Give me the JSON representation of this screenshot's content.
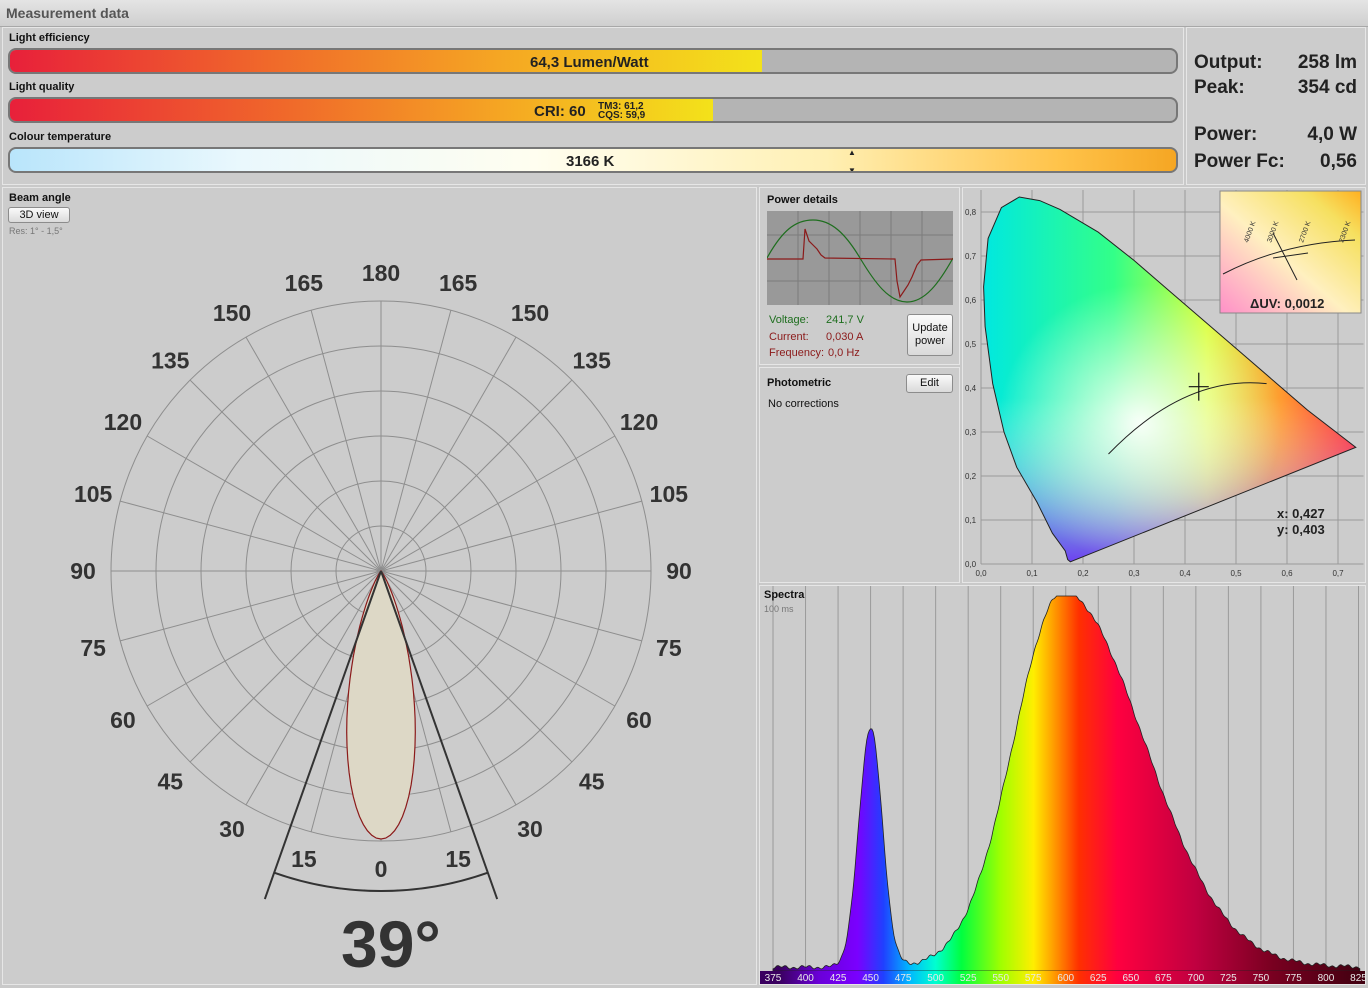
{
  "window": {
    "title": "Measurement data"
  },
  "efficiency": {
    "label": "Light efficiency",
    "value_text": "64,3 Lumen/Watt",
    "fill_fraction": 0.645
  },
  "quality": {
    "label": "Light quality",
    "cri_text": "CRI: 60",
    "tm3_text": "TM3: 61,2",
    "cqs_text": "CQS: 59,9",
    "fill_fraction": 0.603
  },
  "colour_temp": {
    "label": "Colour temperature",
    "value_text": "3166 K"
  },
  "stats": {
    "output_label": "Output:",
    "output_value": "258 lm",
    "peak_label": "Peak:",
    "peak_value": "354 cd",
    "power_label": "Power:",
    "power_value": "4,0 W",
    "powerfc_label": "Power Fc:",
    "powerfc_value": "0,56"
  },
  "beam": {
    "label": "Beam angle",
    "view_button": "3D view",
    "res_text": "Res: 1° - 1,5°",
    "angle_text": "39°",
    "beam_angle_deg": 39,
    "angle_labels": [
      "0",
      "15",
      "30",
      "45",
      "60",
      "75",
      "90",
      "105",
      "120",
      "135",
      "150",
      "165",
      "180"
    ]
  },
  "power_details": {
    "label": "Power details",
    "voltage_label": "Voltage:",
    "voltage_value": "241,7 V",
    "current_label": "Current:",
    "current_value": "0,030 A",
    "frequency_label": "Frequency:",
    "frequency_value": "0,0 Hz",
    "update_button": "Update power"
  },
  "photometric": {
    "label": "Photometric",
    "edit_button": "Edit",
    "status": "No corrections"
  },
  "cie": {
    "x_text": "x: 0,427",
    "y_text": "y: 0,403",
    "duv_text": "ΔUV: 0,0012",
    "x_ticks": [
      "0,0",
      "0,1",
      "0,2",
      "0,3",
      "0,4",
      "0,5",
      "0,6",
      "0,7"
    ],
    "y_ticks": [
      "0,0",
      "0,1",
      "0,2",
      "0,3",
      "0,4",
      "0,5",
      "0,6",
      "0,7",
      "0,8"
    ],
    "point": {
      "x": 0.427,
      "y": 0.403
    },
    "inset_cct_labels": [
      "4000 K",
      "3000 K",
      "2700 K",
      "2300 K"
    ]
  },
  "spectra": {
    "label": "Spectra",
    "exposure_text": "100 ms",
    "wavelength_ticks": [
      "375",
      "400",
      "425",
      "450",
      "475",
      "500",
      "525",
      "550",
      "575",
      "600",
      "625",
      "650",
      "675",
      "700",
      "725",
      "750",
      "775",
      "800",
      "825"
    ],
    "blue_peak_nm": 450,
    "phosphor_peak_nm": 598
  },
  "colors": {
    "accent_green": "#1e6e1e",
    "accent_red": "#8b1a1a"
  }
}
